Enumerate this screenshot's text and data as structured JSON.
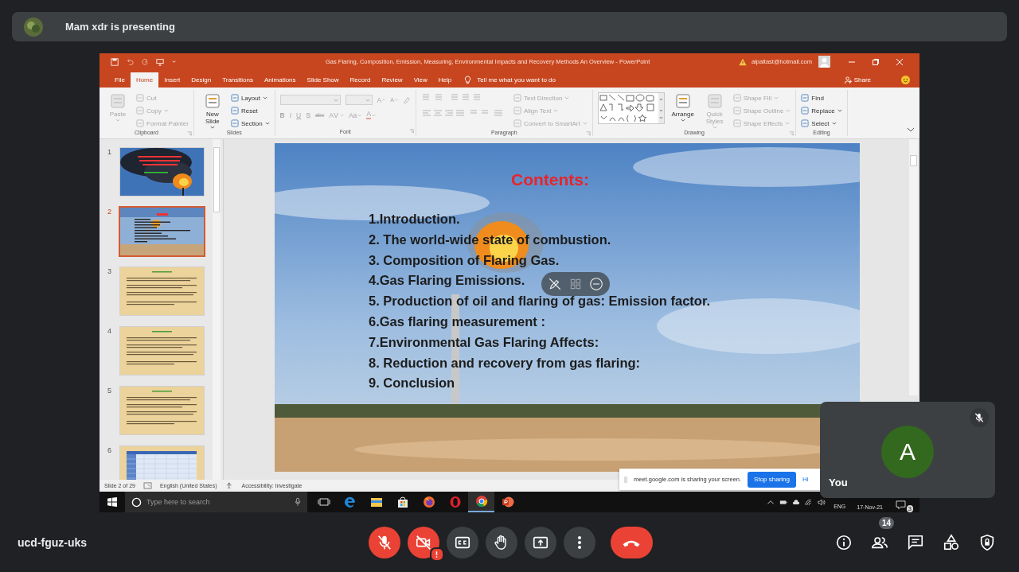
{
  "presenter_banner": {
    "text": "Mam xdr is presenting"
  },
  "powerpoint": {
    "title": "Gas Flaring, Composition, Emission, Measuring, Environmental Impacts and Recovery Methods An Overview  -  PowerPoint",
    "account": "alpaltast@hotmail.com",
    "tabs": [
      {
        "label": "File",
        "selected": false
      },
      {
        "label": "Home",
        "selected": true
      },
      {
        "label": "Insert",
        "selected": false
      },
      {
        "label": "Design",
        "selected": false
      },
      {
        "label": "Transitions",
        "selected": false
      },
      {
        "label": "Animations",
        "selected": false
      },
      {
        "label": "Slide Show",
        "selected": false
      },
      {
        "label": "Record",
        "selected": false
      },
      {
        "label": "Review",
        "selected": false
      },
      {
        "label": "View",
        "selected": false
      },
      {
        "label": "Help",
        "selected": false
      }
    ],
    "tell_me": "Tell me what you want to do",
    "share": "Share",
    "ribbon_groups": [
      {
        "label": "Clipboard",
        "launcher": true,
        "kind": "columns",
        "columns": [
          [
            {
              "kind": "large",
              "label": "Paste",
              "disabled": true,
              "dropdown": true
            }
          ],
          [
            {
              "kind": "small",
              "label": "Cut",
              "disabled": true,
              "dropdown": false
            },
            {
              "kind": "small",
              "label": "Copy",
              "disabled": true,
              "dropdown": true
            },
            {
              "kind": "small",
              "label": "Format Painter",
              "disabled": true,
              "dropdown": false
            }
          ]
        ]
      },
      {
        "label": "Slides",
        "launcher": false,
        "kind": "columns",
        "columns": [
          [
            {
              "kind": "large",
              "label": "New Slide",
              "disabled": false,
              "dropdown": true
            }
          ],
          [
            {
              "kind": "small",
              "label": "Layout",
              "disabled": false,
              "dropdown": true
            },
            {
              "kind": "small",
              "label": "Reset",
              "disabled": false,
              "dropdown": false
            },
            {
              "kind": "small",
              "label": "Section",
              "disabled": false,
              "dropdown": true
            }
          ]
        ]
      },
      {
        "label": "Font",
        "launcher": true,
        "kind": "rows",
        "rows": [
          [
            {
              "kind": "font_combo",
              "disabled": true
            },
            {
              "kind": "size_combo",
              "disabled": true
            },
            {
              "kind": "grow",
              "label": "A",
              "disabled": true
            },
            {
              "kind": "shrink",
              "label": "A",
              "disabled": true
            },
            {
              "kind": "clear",
              "disabled": true
            }
          ],
          [
            {
              "kind": "bold",
              "label": "B",
              "disabled": true
            },
            {
              "kind": "italic",
              "label": "I",
              "disabled": true
            },
            {
              "kind": "underline",
              "label": "U",
              "disabled": true
            },
            {
              "kind": "shadow",
              "label": "S",
              "disabled": true
            },
            {
              "kind": "strike",
              "label": "abc",
              "disabled": true
            },
            {
              "kind": "spacing",
              "label": "AV",
              "disabled": true,
              "dropdown": true
            },
            {
              "kind": "case",
              "label": "Aa",
              "disabled": true,
              "dropdown": true
            },
            {
              "kind": "color",
              "label": "A",
              "disabled": true,
              "dropdown": true
            }
          ]
        ]
      },
      {
        "label": "Paragraph",
        "launcher": true,
        "kind": "columns",
        "columns": [
          [
            {
              "kind": "icon_grid",
              "disabled": true
            }
          ],
          [
            {
              "kind": "small",
              "label": "Text Direction",
              "disabled": true,
              "dropdown": true
            },
            {
              "kind": "small",
              "label": "Align Text",
              "disabled": true,
              "dropdown": true
            },
            {
              "kind": "small",
              "label": "Convert to SmartArt",
              "disabled": true,
              "dropdown": true
            }
          ]
        ]
      },
      {
        "label": "Drawing",
        "launcher": true,
        "kind": "columns",
        "columns": [
          [
            {
              "kind": "gallery",
              "disabled": false
            }
          ],
          [
            {
              "kind": "large",
              "label": "Arrange",
              "disabled": false,
              "dropdown": true
            }
          ],
          [
            {
              "kind": "large",
              "label": "Quick Styles",
              "disabled": true,
              "dropdown": true
            }
          ],
          [
            {
              "kind": "small",
              "label": "Shape Fill",
              "disabled": true,
              "dropdown": true
            },
            {
              "kind": "small",
              "label": "Shape Outline",
              "disabled": true,
              "dropdown": true
            },
            {
              "kind": "small",
              "label": "Shape Effects",
              "disabled": true,
              "dropdown": true
            }
          ]
        ]
      },
      {
        "label": "Editing",
        "launcher": false,
        "kind": "columns",
        "columns": [
          [
            {
              "kind": "small",
              "label": "Find",
              "disabled": false,
              "dropdown": false
            },
            {
              "kind": "small",
              "label": "Replace",
              "disabled": false,
              "dropdown": true
            },
            {
              "kind": "small",
              "label": "Select",
              "disabled": false,
              "dropdown": true
            }
          ]
        ]
      }
    ],
    "thumbnails": [
      {
        "number": "1",
        "kind": "title_photo",
        "selected": false
      },
      {
        "number": "2",
        "kind": "contents_photo",
        "selected": true
      },
      {
        "number": "3",
        "kind": "text_page",
        "selected": false
      },
      {
        "number": "4",
        "kind": "text_page",
        "selected": false
      },
      {
        "number": "5",
        "kind": "text_page",
        "selected": false
      },
      {
        "number": "6",
        "kind": "table",
        "selected": false
      }
    ],
    "slide": {
      "title": "Contents:",
      "items": [
        "1.Introduction.",
        "2. The world-wide state of combustion.",
        "3. Composition of Flaring Gas.",
        "4.Gas Flaring Emissions.",
        "5. Production of oil and flaring of gas: Emission factor.",
        "6.Gas flaring measurement :",
        "7.Environmental Gas Flaring Affects:",
        "8. Reduction and recovery from gas flaring:",
        "9.  Conclusion"
      ]
    },
    "status_bar": {
      "slide": "Slide 2 of 29",
      "language": "English (United States)",
      "accessibility": "Accessibility: Investigate"
    }
  },
  "taskbar": {
    "search_placeholder": "Type here to search",
    "apps": [
      {
        "kind": "taskview",
        "selected": false
      },
      {
        "kind": "edge",
        "selected": false
      },
      {
        "kind": "explorer",
        "selected": false
      },
      {
        "kind": "store",
        "selected": false
      },
      {
        "kind": "firefox",
        "selected": false
      },
      {
        "kind": "opera",
        "selected": false
      },
      {
        "kind": "chrome",
        "selected": true
      },
      {
        "kind": "powerpoint",
        "selected": false
      }
    ],
    "language": "ENG",
    "date": "17-Nov-21",
    "notifications": "3"
  },
  "sharing_notice": {
    "text": "meet.google.com is sharing your screen.",
    "stop_button": "Stop sharing",
    "hide_link": "Hi"
  },
  "self_tile": {
    "initial": "A",
    "name": "You",
    "muted": true
  },
  "meeting_code": "ucd-fguz-uks",
  "controls": [
    {
      "kind": "mic",
      "on": false,
      "alert": false
    },
    {
      "kind": "camera",
      "on": false,
      "alert": true
    },
    {
      "kind": "captions",
      "on": false,
      "alert": false
    },
    {
      "kind": "hand",
      "on": false,
      "alert": false
    },
    {
      "kind": "present",
      "on": false,
      "alert": false
    },
    {
      "kind": "more"
    },
    {
      "kind": "hangup"
    }
  ],
  "side_controls": [
    {
      "kind": "info"
    },
    {
      "kind": "people",
      "badge": "14"
    },
    {
      "kind": "chat"
    },
    {
      "kind": "activities"
    },
    {
      "kind": "host"
    }
  ]
}
